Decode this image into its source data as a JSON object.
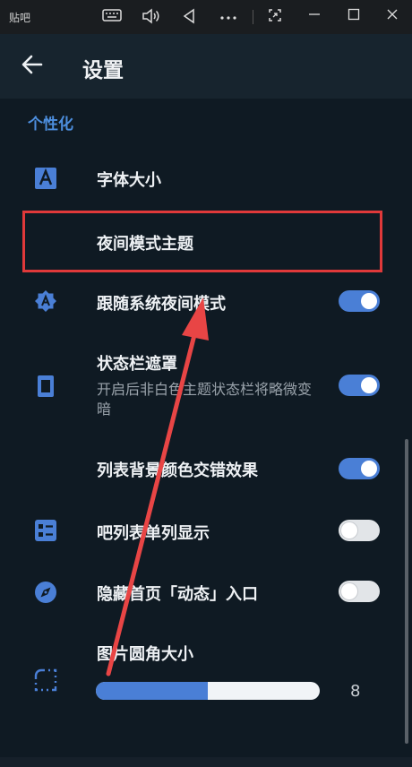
{
  "titlebar": {
    "title": "贴吧",
    "icons": [
      "keyboard-icon",
      "volume-icon",
      "back-triangle-icon",
      "more-icon",
      "screenshot-icon",
      "minimize-icon",
      "maximize-icon",
      "close-icon"
    ]
  },
  "appbar": {
    "title": "设置"
  },
  "section": {
    "title": "个性化"
  },
  "rows": [
    {
      "label": "字体大小",
      "icon": "font-size-icon"
    },
    {
      "label": "夜间模式主题",
      "icon": "moon-icon"
    },
    {
      "label": "跟随系统夜间模式",
      "icon": "auto-theme-icon",
      "toggle": true
    },
    {
      "label": "状态栏遮罩",
      "sub": "开启后非白色主题状态栏将略微变暗",
      "icon": "status-bar-icon",
      "toggle": true
    },
    {
      "label": "列表背景颜色交错效果",
      "toggle": true
    },
    {
      "label": "吧列表单列显示",
      "icon": "list-icon",
      "toggle": false
    },
    {
      "label": "隐藏首页「动态」入口",
      "icon": "compass-icon",
      "toggle": false
    },
    {
      "label": "图片圆角大小",
      "icon": "corner-icon"
    }
  ],
  "slider": {
    "value": "8",
    "fraction": 0.5
  },
  "colors": {
    "accent": "#4a7fd6",
    "highlight": "#e0393a",
    "background": "#0f1a23"
  }
}
